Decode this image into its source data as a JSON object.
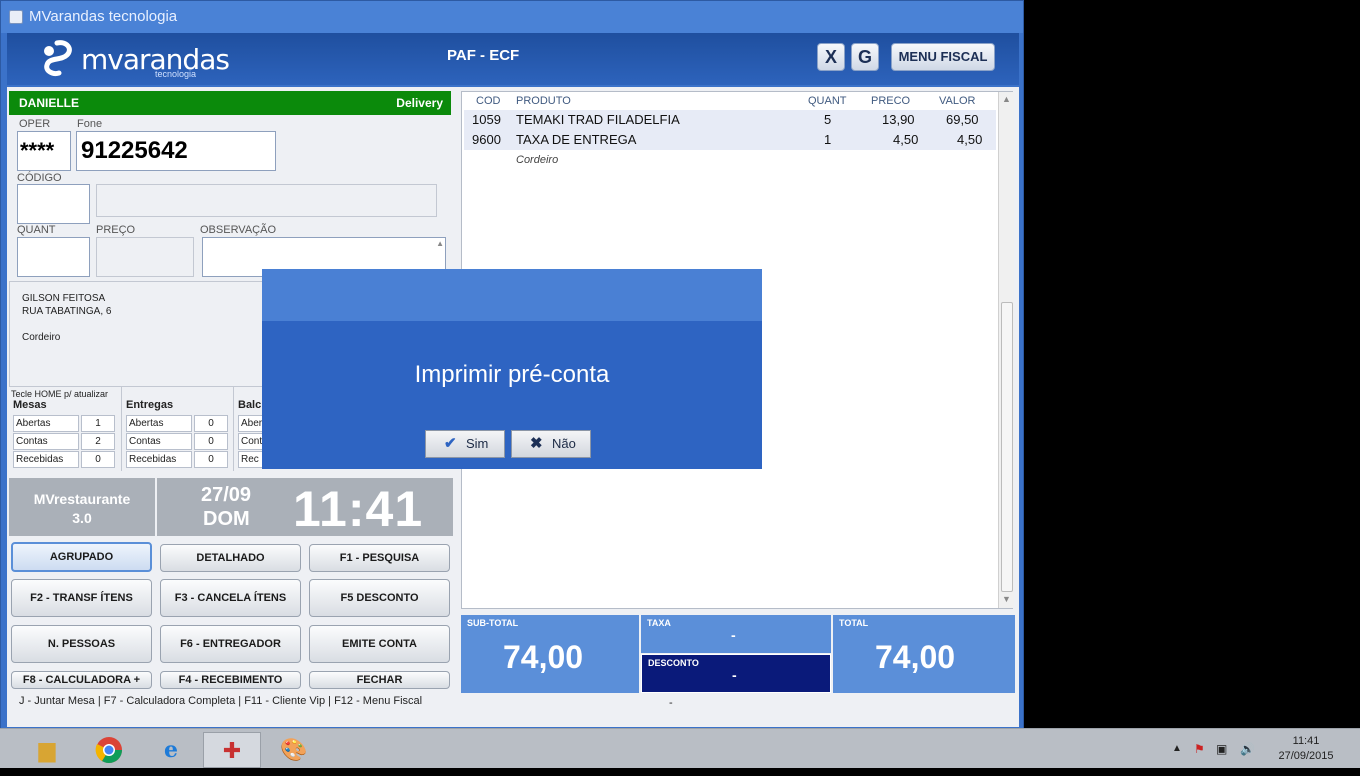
{
  "window": {
    "title": "MVarandas tecnologia"
  },
  "header": {
    "logo_name": "mvarandas",
    "logo_sub": "tecnologia",
    "title": "PAF - ECF",
    "btn_x": "X",
    "btn_g": "G",
    "btn_menu": "MENU FISCAL"
  },
  "client": {
    "name": "DANIELLE",
    "mode": "Delivery"
  },
  "form": {
    "oper_label": "OPER",
    "oper_value": "****",
    "fone_label": "Fone",
    "fone_value": "91225642",
    "codigo_label": "CÓDIGO",
    "quant_label": "QUANT",
    "preco_label": "PREÇO",
    "obs_label": "OBSERVAÇÃO"
  },
  "address": {
    "line1": "GILSON FEITOSA",
    "line2": "RUA TABATINGA, 6",
    "line3": "Cordeiro"
  },
  "stats": {
    "hint": "Tecle HOME  p/ atualizar",
    "mesas": {
      "title": "Mesas",
      "rows": [
        {
          "k": "Abertas",
          "v": "1"
        },
        {
          "k": "Contas",
          "v": "2"
        },
        {
          "k": "Recebidas",
          "v": "0"
        }
      ]
    },
    "entregas": {
      "title": "Entregas",
      "rows": [
        {
          "k": "Abertas",
          "v": "0"
        },
        {
          "k": "Contas",
          "v": "0"
        },
        {
          "k": "Recebidas",
          "v": "0"
        }
      ]
    },
    "balcao": {
      "title": "Balc",
      "rows": [
        {
          "k": "Aber"
        },
        {
          "k": "Cont"
        },
        {
          "k": "Rec"
        }
      ]
    }
  },
  "brand": {
    "line1": "MVrestaurante",
    "line2": "3.0"
  },
  "clock": {
    "date": "27/09",
    "day": "DOM",
    "time": "11:41"
  },
  "buttons": {
    "agrupado": "AGRUPADO",
    "detalhado": "DETALHADO",
    "pesquisa": "F1 - PESQUISA",
    "transf": "F2 - TRANSF ÍTENS",
    "cancela": "F3 - CANCELA ÍTENS",
    "desconto": "F5 DESCONTO",
    "pessoas": "N. PESSOAS",
    "entregador": "F6 - ENTREGADOR",
    "emite": "EMITE CONTA",
    "calc": "F8 - CALCULADORA +",
    "receb": "F4 - RECEBIMENTO",
    "fechar": "FECHAR"
  },
  "shortcuts": "J - Juntar Mesa   |  F7 - Calculadora  Completa   |  F11 - Cliente Vip   |  F12 - Menu Fiscal",
  "grid": {
    "headers": {
      "cod": "COD",
      "produto": "PRODUTO",
      "quant": "QUANT",
      "preco": "PRECO",
      "valor": "VALOR"
    },
    "rows": [
      {
        "cod": "1059",
        "produto": "TEMAKI TRAD FILADELFIA",
        "quant": "5",
        "preco": "13,90",
        "valor": "69,50"
      },
      {
        "cod": "9600",
        "produto": "TAXA DE ENTREGA",
        "quant": "1",
        "preco": "4,50",
        "valor": "4,50"
      }
    ],
    "sub": "Cordeiro"
  },
  "totals": {
    "subtotal_label": "SUB-TOTAL",
    "subtotal": "74,00",
    "taxa_label": "TAXA",
    "taxa": "-",
    "desconto_label": "DESCONTO",
    "desconto": "-",
    "total_label": "TOTAL",
    "total": "74,00",
    "footer_dash": "-"
  },
  "dialog": {
    "message": "Imprimir pré-conta",
    "yes": "Sim",
    "no": "Não"
  },
  "taskbar": {
    "time": "11:41",
    "date": "27/09/2015"
  },
  "colors": {
    "accent": "#2e64c2",
    "client_bar": "#0b8a0b",
    "desconto_bg": "#0a1a7a"
  }
}
